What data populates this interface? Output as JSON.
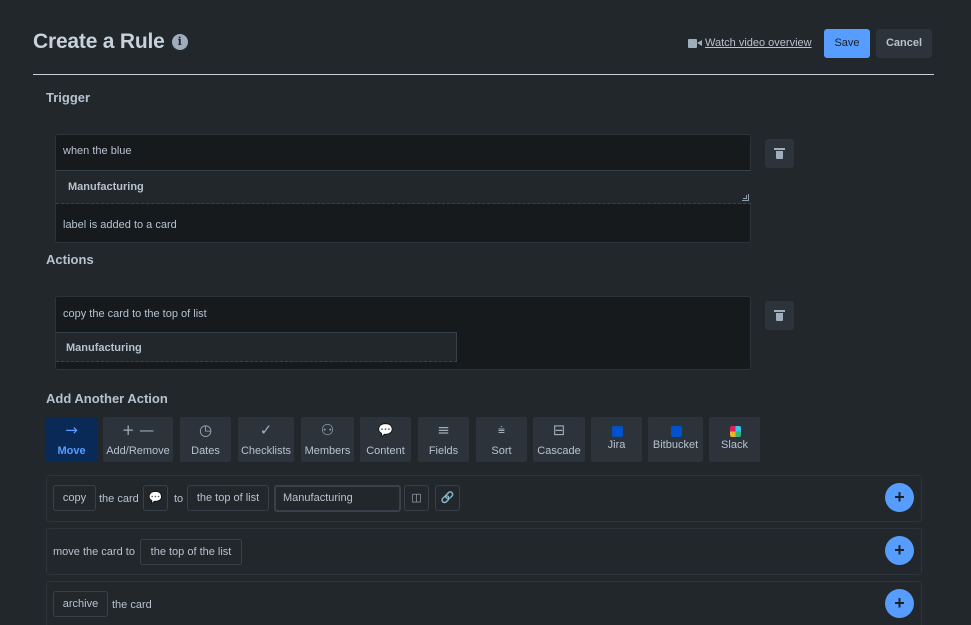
{
  "header": {
    "title": "Create a Rule",
    "info_icon": "i",
    "video_link": "Watch video overview",
    "save_label": "Save",
    "cancel_label": "Cancel"
  },
  "trigger": {
    "section_label": "Trigger",
    "line1": "when the blue",
    "select_value": "Manufacturing",
    "line2": "label is added to a card"
  },
  "actions": {
    "section_label": "Actions",
    "line1": "copy the card to the top of list",
    "select_value": "Manufacturing"
  },
  "add_action": {
    "section_label": "Add Another Action",
    "tabs": [
      {
        "label": "Move",
        "icon": "→",
        "icon_name": "arrow-right-icon"
      },
      {
        "label": "Add/Remove",
        "icon": "+ —",
        "icon_name": "add-remove-icon"
      },
      {
        "label": "Dates",
        "icon": "◷",
        "icon_name": "clock-icon"
      },
      {
        "label": "Checklists",
        "icon": "✓",
        "icon_name": "checkmark-icon"
      },
      {
        "label": "Members",
        "icon": "⚇",
        "icon_name": "person-icon"
      },
      {
        "label": "Content",
        "icon": "💬",
        "icon_name": "comment-icon"
      },
      {
        "label": "Fields",
        "icon": "≡",
        "icon_name": "fields-icon"
      },
      {
        "label": "Sort",
        "icon": "⩧",
        "icon_name": "sort-icon"
      },
      {
        "label": "Cascade",
        "icon": "⊟",
        "icon_name": "cascade-icon"
      },
      {
        "label": "Jira",
        "icon": "",
        "icon_name": "jira-icon"
      },
      {
        "label": "Bitbucket",
        "icon": "",
        "icon_name": "bitbucket-icon"
      },
      {
        "label": "Slack",
        "icon": "",
        "icon_name": "slack-icon"
      }
    ],
    "rows": {
      "copy": {
        "verb": "copy",
        "text1": "the card",
        "text2": "to",
        "position": "the top of list",
        "list_value": "Manufacturing"
      },
      "move": {
        "text": "move the card to",
        "position": "the top of the list"
      },
      "archive": {
        "verb": "archive",
        "text": "the card"
      },
      "plus": "+"
    }
  },
  "colors": {
    "background": "#22272b",
    "accent": "#579dff",
    "active_tab_bg": "#092957",
    "jira": "#0052cc",
    "bitbucket": "#0052cc"
  }
}
